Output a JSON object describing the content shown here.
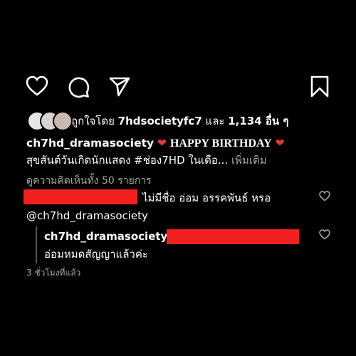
{
  "actions": {
    "like_icon": "heart-outline-icon",
    "comment_icon": "speech-bubble-icon",
    "share_icon": "paper-plane-icon",
    "save_icon": "bookmark-icon"
  },
  "likes": {
    "prefix": "ถูกใจโดย",
    "username": "7hdsocietyfc7",
    "connector": "และ",
    "count_text": "1,134 อื่น ๆ"
  },
  "caption": {
    "username": "ch7hd_dramasociety",
    "heading": "HAPPY BIRTHDAY",
    "text": "สุขสันต์วันเกิดนักแสดง #ช่อง7HD ในเดือ...",
    "more_label": "เพิ่มเติม"
  },
  "view_comments": "ดูความคิดเห็นทั้ง 50 รายการ",
  "comments": [
    {
      "text": "ไม่มีชื่อ อ่อม อรรคพันธ์ หรอ",
      "mention": "@ch7hd_dramasociety"
    },
    {
      "username": "ch7hd_dramasociety",
      "text": "อ่อมหมดสัญญาแล้วค่ะ"
    }
  ],
  "timestamp": "3 ชั่วโมงที่แล้ว",
  "colors": {
    "background": "#000000",
    "text": "#ffffff",
    "muted": "#a8a8a8",
    "redaction": "#f21f1f",
    "heart": "#e53935"
  }
}
